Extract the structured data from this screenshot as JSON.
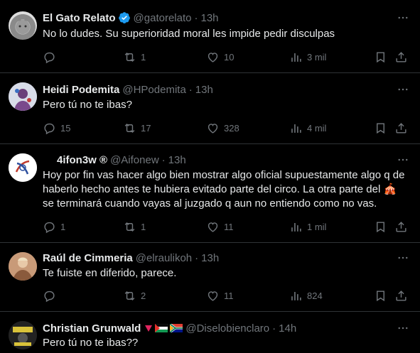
{
  "tweets": [
    {
      "name": "El Gato Relato",
      "verified": true,
      "handle": "@gatorelato",
      "time": "13h",
      "text": "No lo dudes. Su superioridad moral les impide pedir disculpas",
      "replies": "",
      "reposts": "1",
      "likes": "10",
      "views": "3 mil"
    },
    {
      "name": "Heidi Podemita",
      "verified": false,
      "handle": "@HPodemita",
      "time": "13h",
      "text": "Pero tú no te ibas?",
      "replies": "15",
      "reposts": "17",
      "likes": "328",
      "views": "4 mil"
    },
    {
      "name": "4ifon3w ®",
      "verified": false,
      "handle": "@Aifonew",
      "time": "13h",
      "text": "Hoy por fin vas hacer algo bien mostrar algo oficial supuestamente algo q de haberlo hecho antes te hubiera evitado parte del circo. La otra parte del 🎪 se terminará cuando vayas al juzgado q aun no entiendo como no vas.",
      "replies": "1",
      "reposts": "1",
      "likes": "11",
      "views": "1 mil"
    },
    {
      "name": "Raúl de Cimmeria",
      "verified": false,
      "handle": "@elraulikoh",
      "time": "13h",
      "text": "Te fuiste en diferido, parece.",
      "replies": "",
      "reposts": "2",
      "likes": "11",
      "views": "824"
    },
    {
      "name": "Christian Grunwald",
      "verified": false,
      "handle": "@Diselobienclaro",
      "time": "14h",
      "text": "Pero tú no te ibas??",
      "replies": "",
      "reposts": "",
      "likes": "",
      "views": ""
    }
  ],
  "colors": {
    "background": "#000000",
    "text": "#e7e9ea",
    "secondary": "#71767b",
    "border": "#2f3336",
    "verified": "#1d9bf0"
  },
  "icons": [
    "reply-icon",
    "repost-icon",
    "like-icon",
    "views-icon",
    "bookmark-icon",
    "share-icon",
    "more-icon",
    "verified-icon"
  ]
}
